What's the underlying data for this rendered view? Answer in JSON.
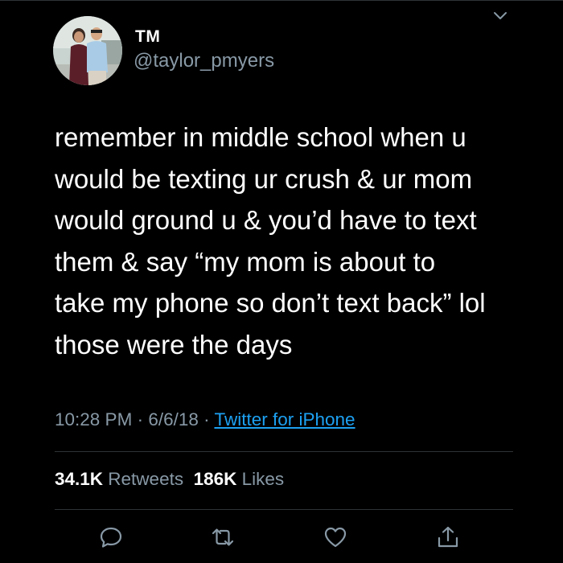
{
  "user": {
    "display_name": "TM",
    "handle": "@taylor_pmyers"
  },
  "tweet": {
    "lines": [
      "remember in middle school when u",
      "would be texting ur crush & ur mom",
      "would ground u & you’d have to text",
      "them & say “my mom is about to",
      "take my phone so don’t text back” lol",
      "those were the days"
    ]
  },
  "meta": {
    "time": "10:28 PM",
    "sep1": " · ",
    "date": "6/6/18",
    "sep2": " · ",
    "source": "Twitter for iPhone"
  },
  "stats": {
    "retweets_count": "34.1K",
    "retweets_label": " Retweets",
    "likes_count": "186K",
    "likes_label": " Likes"
  },
  "actions": [
    "reply-icon",
    "retweet-icon",
    "like-icon",
    "share-icon"
  ],
  "colors": {
    "background": "#000000",
    "text": "#ffffff",
    "secondary": "#8899a6",
    "link": "#1da1f2",
    "divider": "#2f3336"
  }
}
